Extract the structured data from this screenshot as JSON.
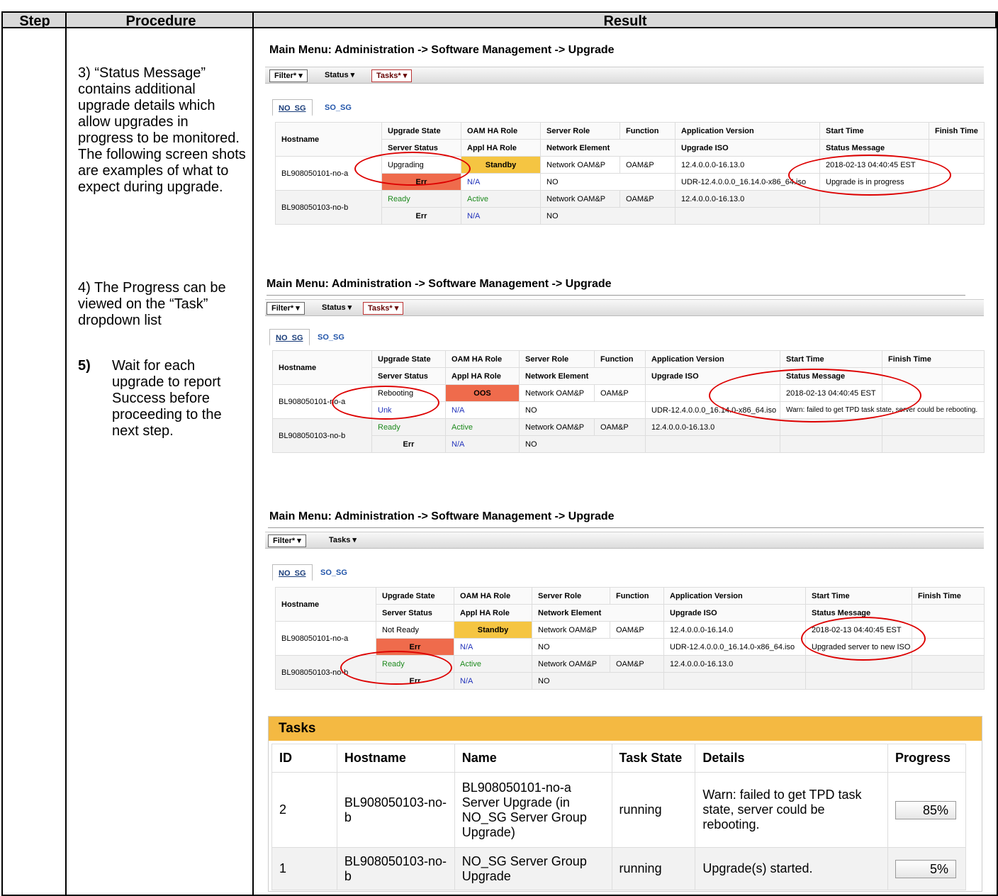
{
  "headers": {
    "step": "Step",
    "procedure": "Procedure",
    "result": "Result"
  },
  "procedure": {
    "p3": "3) “Status Message” contains additional upgrade details which allow upgrades in progress to be monitored.  The following screen shots are examples of what to expect during upgrade.",
    "p4": "4) The Progress can be viewed on the “Task” dropdown list",
    "p5_num": "5)",
    "p5": "Wait for each upgrade to report Success before proceeding to the next step."
  },
  "screens": [
    {
      "title": "Main Menu: Administration -> Software Management -> Upgrade",
      "toolbar": [
        "Filter*",
        "Status",
        "Tasks*"
      ],
      "tabs": [
        "NO_SG",
        "SO_SG"
      ],
      "head1": [
        "Hostname",
        "Upgrade State",
        "OAM HA Role",
        "Server Role",
        "Function",
        "Application Version",
        "Start Time",
        "Finish Time"
      ],
      "head2": [
        "Server Status",
        "Appl HA Role",
        "Network Element",
        "",
        "Upgrade ISO",
        "Status Message",
        ""
      ],
      "rows": [
        {
          "host": "BL908050101-no-a",
          "r1": [
            "Upgrading",
            "Standby",
            "Network OAM&P",
            "OAM&P",
            "12.4.0.0.0-16.13.0",
            "2018-02-13 04:40:45 EST",
            ""
          ],
          "r2": [
            "Err",
            "N/A",
            "NO",
            "",
            "UDR-12.4.0.0.0_16.14.0-x86_64.iso",
            "Upgrade is in progress",
            ""
          ]
        },
        {
          "host": "BL908050103-no-b",
          "r1": [
            "Ready",
            "Active",
            "Network OAM&P",
            "OAM&P",
            "12.4.0.0.0-16.13.0",
            "",
            ""
          ],
          "r2": [
            "Err",
            "N/A",
            "NO",
            "",
            "",
            "",
            ""
          ]
        }
      ]
    },
    {
      "title": "Main Menu: Administration -> Software Management -> Upgrade",
      "toolbar": [
        "Filter*",
        "Status",
        "Tasks*"
      ],
      "tabs": [
        "NO_SG",
        "SO_SG"
      ],
      "head1": [
        "Hostname",
        "Upgrade State",
        "OAM HA Role",
        "Server Role",
        "Function",
        "Application Version",
        "Start Time",
        "Finish Time"
      ],
      "head2": [
        "Server Status",
        "Appl HA Role",
        "Network Element",
        "",
        "Upgrade ISO",
        "Status Message",
        ""
      ],
      "rows": [
        {
          "host": "BL908050101-no-a",
          "r1": [
            "Rebooting",
            "OOS",
            "Network OAM&P",
            "OAM&P",
            "",
            "2018-02-13 04:40:45 EST",
            ""
          ],
          "r2": [
            "Unk",
            "N/A",
            "NO",
            "",
            "UDR-12.4.0.0.0_16.14.0-x86_64.iso",
            "Warn: failed to get TPD task state, server could be rebooting.",
            ""
          ]
        },
        {
          "host": "BL908050103-no-b",
          "r1": [
            "Ready",
            "Active",
            "Network OAM&P",
            "OAM&P",
            "12.4.0.0.0-16.13.0",
            "",
            ""
          ],
          "r2": [
            "Err",
            "N/A",
            "NO",
            "",
            "",
            "",
            ""
          ]
        }
      ]
    },
    {
      "title": "Main Menu: Administration -> Software Management -> Upgrade",
      "toolbar": [
        "Filter*",
        "Tasks"
      ],
      "tabs": [
        "NO_SG",
        "SO_SG"
      ],
      "head1": [
        "Hostname",
        "Upgrade State",
        "OAM HA Role",
        "Server Role",
        "Function",
        "Application Version",
        "Start Time",
        "Finish Time"
      ],
      "head2": [
        "Server Status",
        "Appl HA Role",
        "Network Element",
        "",
        "Upgrade ISO",
        "Status Message",
        ""
      ],
      "rows": [
        {
          "host": "BL908050101-no-a",
          "r1": [
            "Not Ready",
            "Standby",
            "Network OAM&P",
            "OAM&P",
            "12.4.0.0.0-16.14.0",
            "2018-02-13 04:40:45 EST",
            ""
          ],
          "r2": [
            "Err",
            "N/A",
            "NO",
            "",
            "UDR-12.4.0.0.0_16.14.0-x86_64.iso",
            "Upgraded server to new ISO",
            ""
          ]
        },
        {
          "host": "BL908050103-no-b",
          "r1": [
            "Ready",
            "Active",
            "Network OAM&P",
            "OAM&P",
            "12.4.0.0.0-16.13.0",
            "",
            ""
          ],
          "r2": [
            "Err",
            "N/A",
            "NO",
            "",
            "",
            "",
            ""
          ]
        }
      ]
    }
  ],
  "tasks": {
    "title": "Tasks",
    "columns": [
      "ID",
      "Hostname",
      "Name",
      "Task State",
      "Details",
      "Progress"
    ],
    "rows": [
      {
        "id": "2",
        "host": "BL908050103-no-b",
        "name": "BL908050101-no-a Server Upgrade (in NO_SG Server Group Upgrade)",
        "state": "running",
        "details": "Warn: failed to get TPD task state, server could be rebooting.",
        "progress": "85%"
      },
      {
        "id": "1",
        "host": "BL908050103-no-b",
        "name": "NO_SG Server Group Upgrade",
        "state": "running",
        "details": "Upgrade(s) started.",
        "progress": "5%"
      }
    ]
  },
  "colors": {
    "header_bg": "#d9d9d9",
    "err": "#ef6b4c",
    "standby": "#f5c542",
    "tasks_bar": "#f4b942",
    "ellipse": "#dd0000"
  }
}
